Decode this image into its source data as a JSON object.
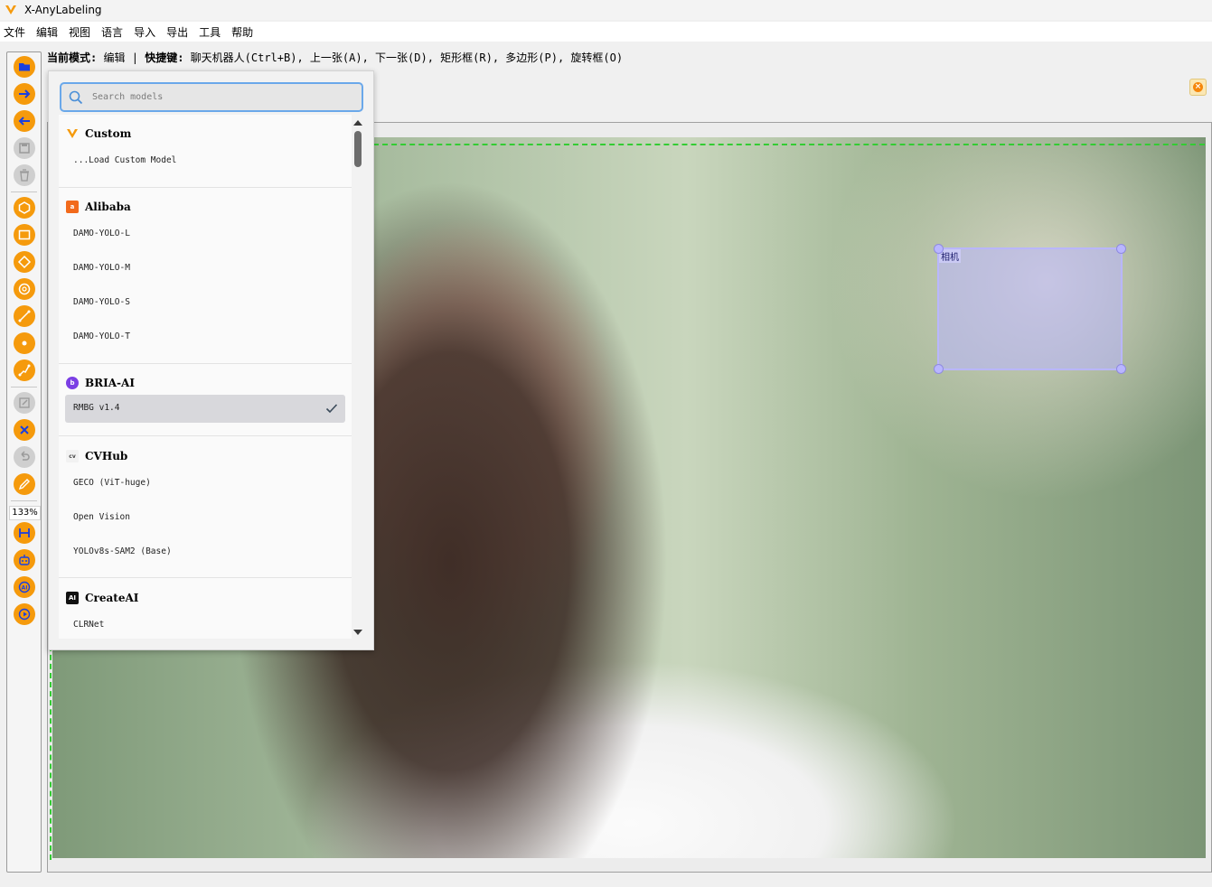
{
  "window": {
    "title": "X-AnyLabeling"
  },
  "menu": [
    "文件",
    "编辑",
    "视图",
    "语言",
    "导入",
    "导出",
    "工具",
    "帮助"
  ],
  "status": {
    "mode_label": "当前模式:",
    "mode_value": "编辑",
    "divider": "|",
    "shortcut_label": "快捷键:",
    "shortcut_text": "聊天机器人(Ctrl+B), 上一张(A), 下一张(D), 矩形框(R), 多边形(P), 旋转框(O)"
  },
  "toolbar": {
    "zoom": "133%",
    "tools": [
      "open-folder-icon",
      "next-image-icon",
      "prev-image-icon",
      "save-icon",
      "delete-icon",
      "polygon-icon",
      "rectangle-icon",
      "rotation-icon",
      "circle-icon",
      "line-icon",
      "point-icon",
      "linestrip-icon",
      "edit-icon",
      "delete-shape-icon",
      "undo-icon",
      "brush-icon",
      "fit-width-icon",
      "auto-label-icon",
      "ai-icon",
      "run-icon"
    ]
  },
  "model_picker": {
    "search_placeholder": "Search models",
    "groups": [
      {
        "name": "Custom",
        "logo_color": "#f59a0c",
        "items": [
          "...Load Custom Model"
        ]
      },
      {
        "name": "Alibaba",
        "logo_color": "#f26a1b",
        "items": [
          "DAMO-YOLO-L",
          "DAMO-YOLO-M",
          "DAMO-YOLO-S",
          "DAMO-YOLO-T"
        ]
      },
      {
        "name": "BRIA-AI",
        "logo_color": "#7b3fe4",
        "items": [
          "RMBG v1.4"
        ],
        "selected": "RMBG v1.4"
      },
      {
        "name": "CVHub",
        "logo_color": "#444444",
        "items": [
          "GECO (ViT-huge)",
          "Open Vision",
          "YOLOv8s-SAM2 (Base)"
        ]
      },
      {
        "name": "CreateAI",
        "logo_color": "#111111",
        "items": [
          "CLRNet"
        ]
      }
    ]
  },
  "canvas": {
    "annotation_label": "相机"
  },
  "colors": {
    "accent_orange": "#f59a0c",
    "search_border": "#6aa8ea",
    "bbox_fill": "#b9b6ff",
    "guide_green": "#33cc33"
  }
}
